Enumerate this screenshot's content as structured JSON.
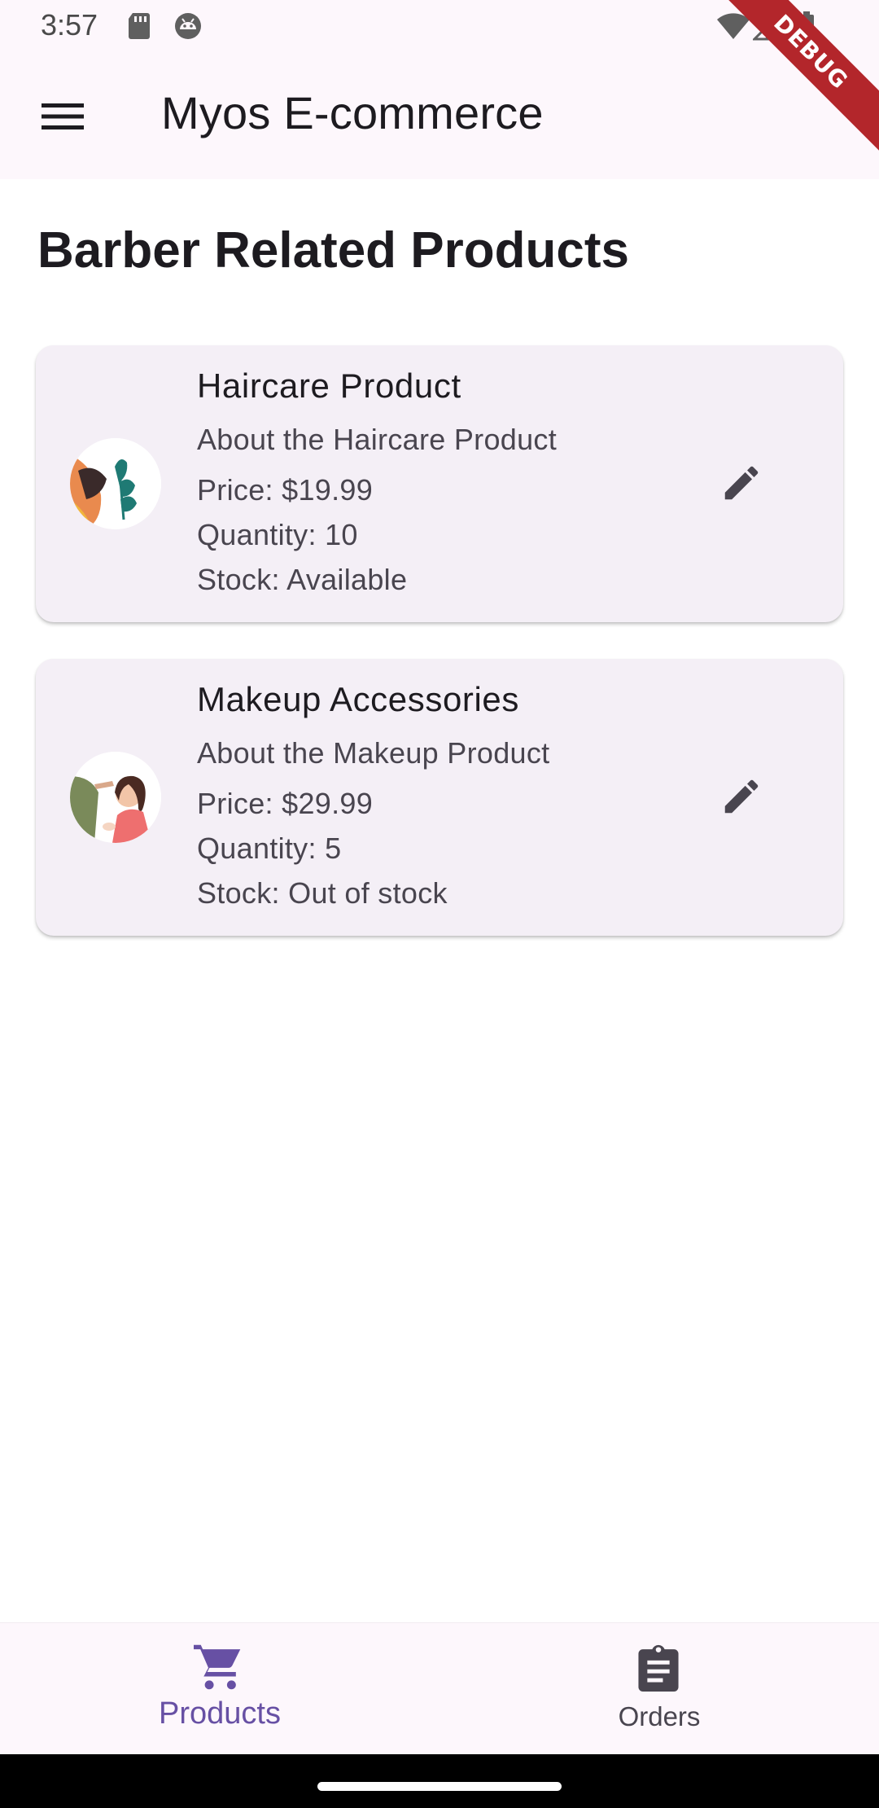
{
  "status_bar": {
    "time": "3:57",
    "icons": [
      "sd-card-icon",
      "android-debug-icon",
      "wifi-icon",
      "signal-icon",
      "battery-icon"
    ]
  },
  "debug_banner": "DEBUG",
  "app_bar": {
    "title": "Myos E-commerce",
    "menu_icon": "menu-icon"
  },
  "section_title": "Barber Related Products",
  "products": [
    {
      "name": "Haircare Product",
      "description": "About the Haircare Product",
      "price": "Price: $19.99",
      "quantity": "Quantity: 10",
      "stock": "Stock: Available",
      "action_icon": "edit-icon"
    },
    {
      "name": "Makeup Accessories",
      "description": "About the Makeup Product",
      "price": "Price: $29.99",
      "quantity": "Quantity: 5",
      "stock": "Stock: Out of stock",
      "action_icon": "edit-icon"
    }
  ],
  "bottom_nav": {
    "items": [
      {
        "label": "Products",
        "icon": "shopping-cart-icon",
        "selected": true
      },
      {
        "label": "Orders",
        "icon": "clipboard-icon",
        "selected": false
      }
    ]
  },
  "colors": {
    "accent": "#6750a4",
    "app_bar_bg": "#fdf7fc",
    "card_bg": "#f4eff6",
    "debug_ribbon": "#b3262b"
  }
}
